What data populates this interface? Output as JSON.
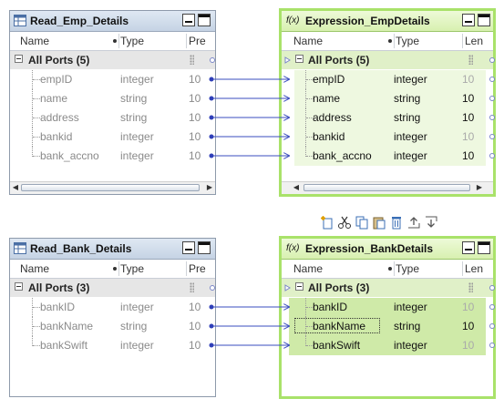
{
  "panels": {
    "read_emp": {
      "title": "Read_Emp_Details",
      "columns": {
        "name": "Name",
        "type": "Type",
        "prec": "Pre"
      },
      "group": "All Ports (5)",
      "rows": [
        {
          "name": "empID",
          "type": "integer",
          "prec": "10"
        },
        {
          "name": "name",
          "type": "string",
          "prec": "10"
        },
        {
          "name": "address",
          "type": "string",
          "prec": "10"
        },
        {
          "name": "bankid",
          "type": "integer",
          "prec": "10"
        },
        {
          "name": "bank_accno",
          "type": "integer",
          "prec": "10"
        }
      ]
    },
    "expr_emp": {
      "title": "Expression_EmpDetails",
      "columns": {
        "name": "Name",
        "type": "Type",
        "prec": "Len"
      },
      "group": "All Ports (5)",
      "rows": [
        {
          "name": "empID",
          "type": "integer",
          "prec": "10"
        },
        {
          "name": "name",
          "type": "string",
          "prec": "10"
        },
        {
          "name": "address",
          "type": "string",
          "prec": "10"
        },
        {
          "name": "bankid",
          "type": "integer",
          "prec": "10"
        },
        {
          "name": "bank_accno",
          "type": "integer",
          "prec": "10"
        }
      ]
    },
    "read_bank": {
      "title": "Read_Bank_Details",
      "columns": {
        "name": "Name",
        "type": "Type",
        "prec": "Pre"
      },
      "group": "All Ports (3)",
      "rows": [
        {
          "name": "bankID",
          "type": "integer",
          "prec": "10"
        },
        {
          "name": "bankName",
          "type": "string",
          "prec": "10"
        },
        {
          "name": "bankSwift",
          "type": "integer",
          "prec": "10"
        }
      ]
    },
    "expr_bank": {
      "title": "Expression_BankDetails",
      "columns": {
        "name": "Name",
        "type": "Type",
        "prec": "Len"
      },
      "group": "All Ports (3)",
      "rows": [
        {
          "name": "bankID",
          "type": "integer",
          "prec": "10"
        },
        {
          "name": "bankName",
          "type": "string",
          "prec": "10"
        },
        {
          "name": "bankSwift",
          "type": "integer",
          "prec": "10"
        }
      ]
    }
  },
  "expr_icon_label": "f(x)",
  "toolbar_icons": [
    "new-port-icon",
    "cut-icon",
    "copy-icon",
    "paste-icon",
    "delete-icon",
    "move-up-icon",
    "move-down-icon"
  ],
  "colors": {
    "link": "#3a4dbf",
    "expression_border": "#a9e26a",
    "source_header": "#c5d3e4"
  }
}
